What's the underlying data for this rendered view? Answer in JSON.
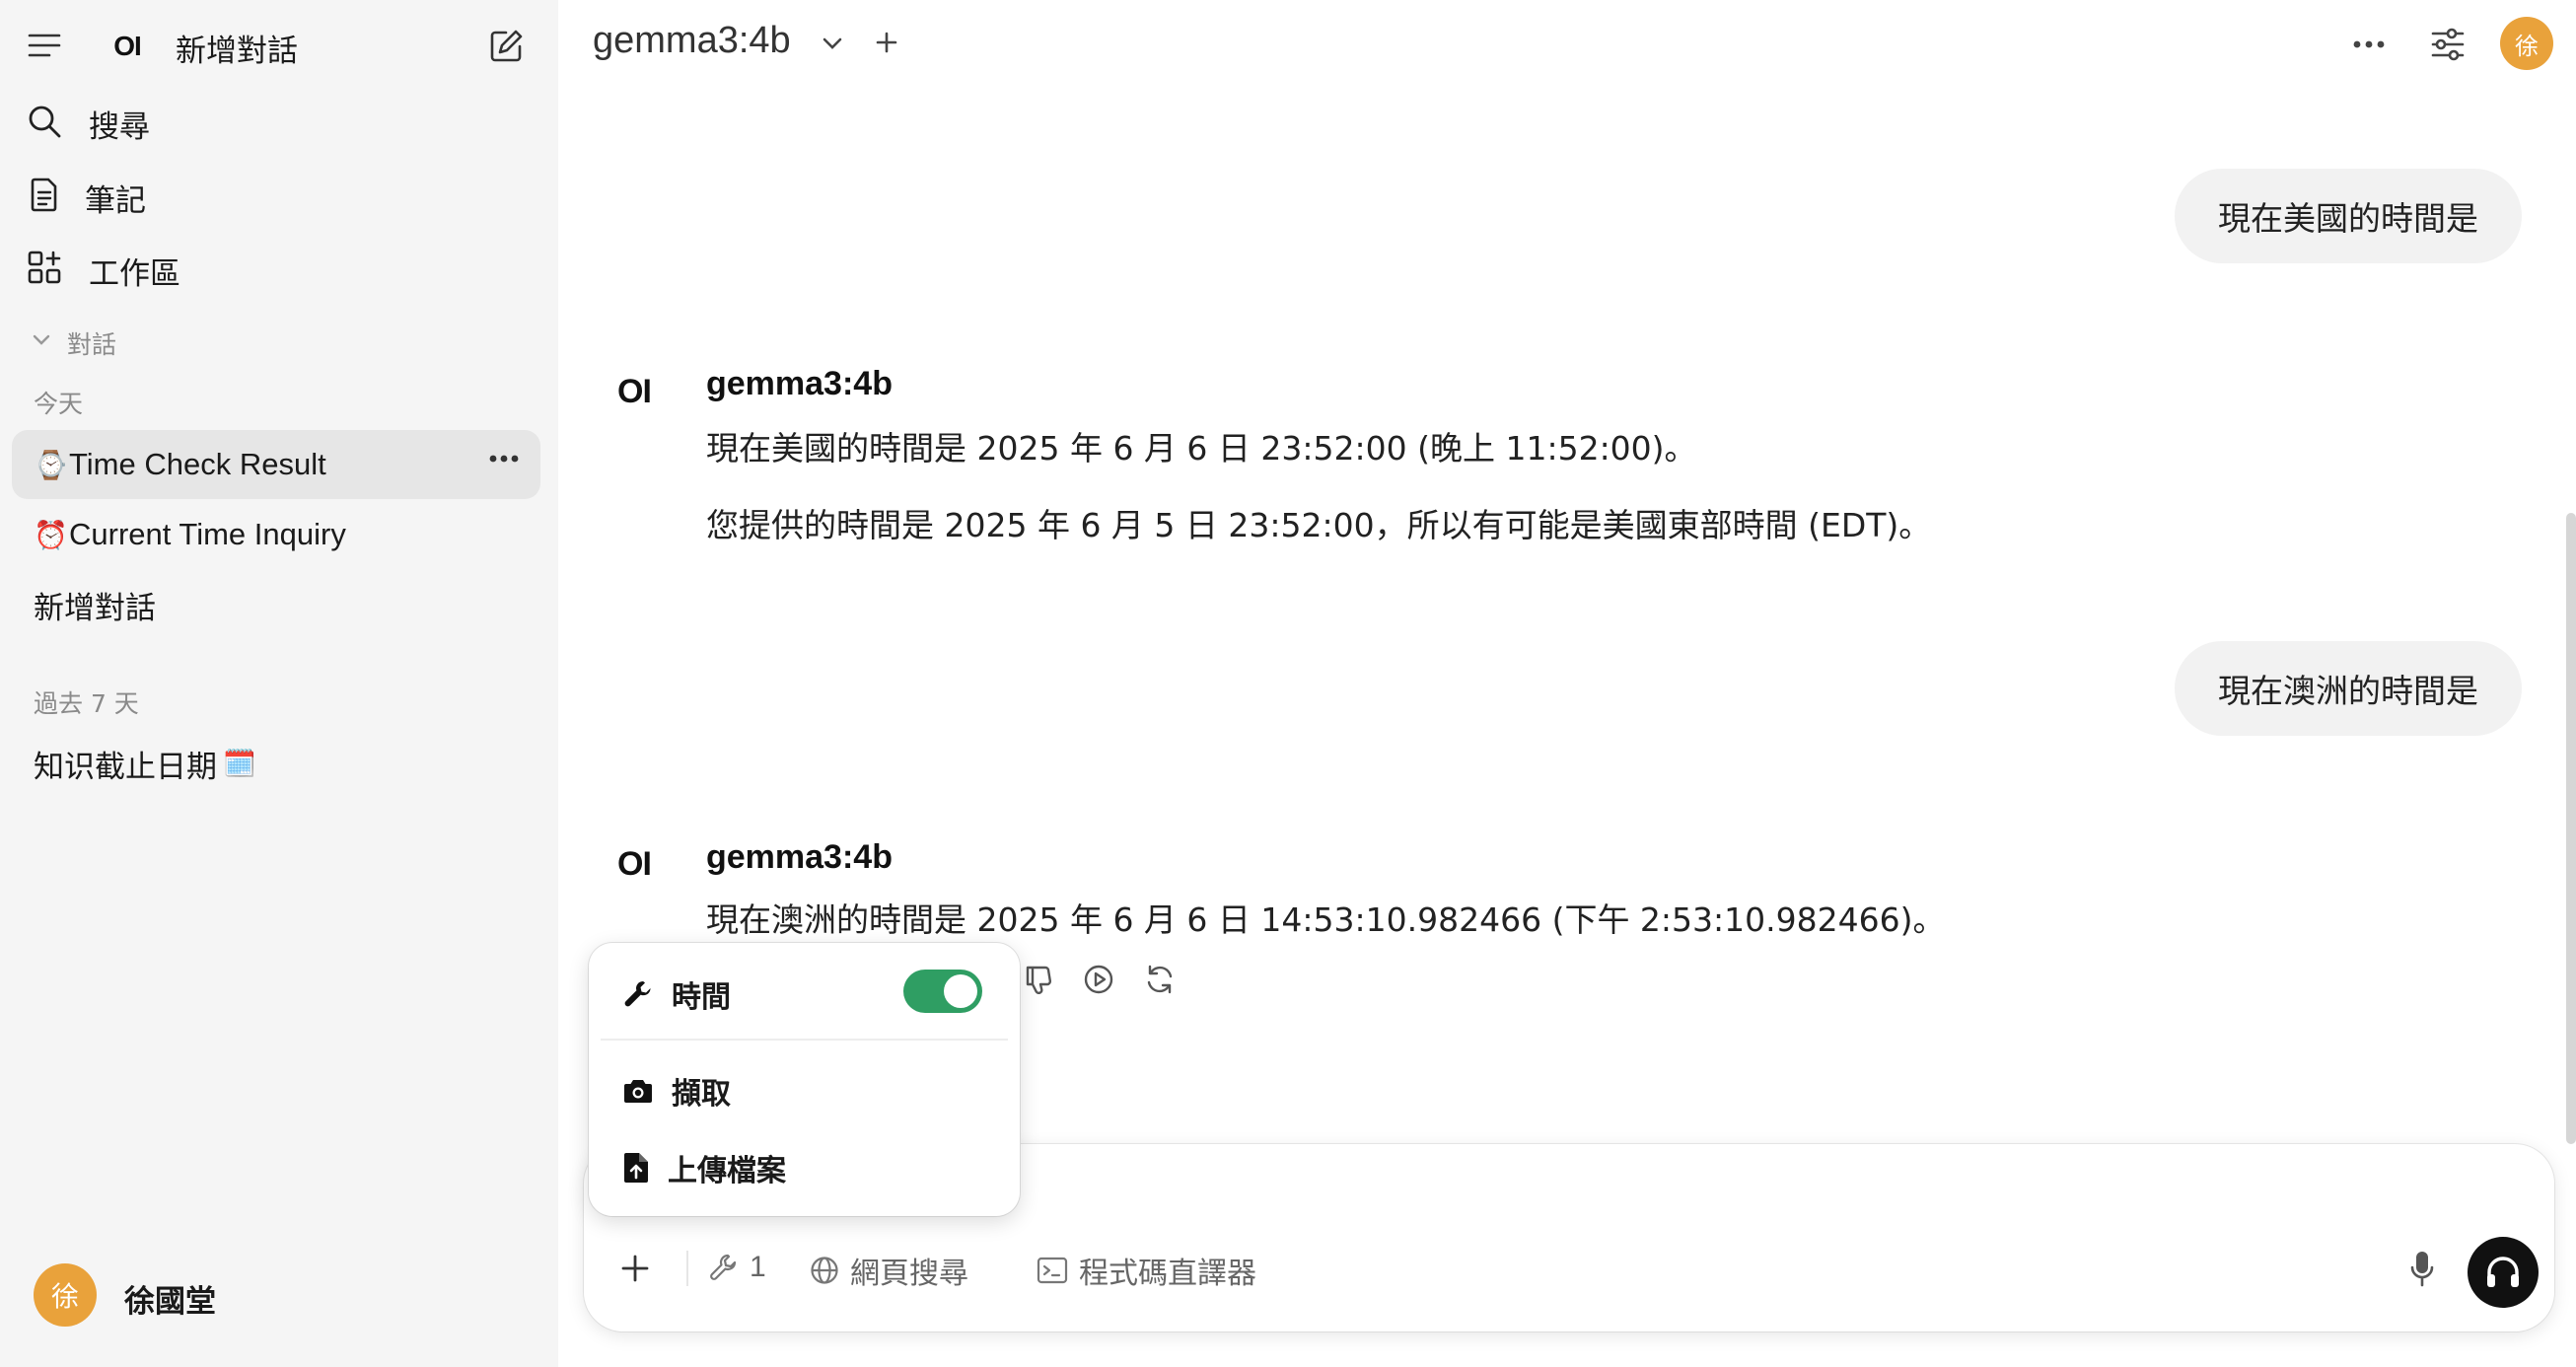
{
  "sidebar": {
    "new_chat_label": "新增對話",
    "logo_text": "OI",
    "nav": {
      "search": "搜尋",
      "notes": "筆記",
      "workspace": "工作區"
    },
    "conversations_header": "對話",
    "section_today": "今天",
    "today_items": [
      {
        "emoji": "⌚",
        "title": "Time Check Result"
      },
      {
        "emoji": "⏰",
        "title": "Current Time Inquiry"
      },
      {
        "emoji": "",
        "title": "新增對話"
      }
    ],
    "section_past7": "過去 7 天",
    "past7_items": [
      {
        "title": "知识截止日期",
        "emoji": "🗓️"
      }
    ],
    "user": {
      "avatar_char": "徐",
      "name": "徐國堂"
    }
  },
  "header": {
    "model_name": "gemma3:4b",
    "avatar_char": "徐"
  },
  "messages": [
    {
      "role": "user",
      "text": "現在美國的時間是"
    },
    {
      "role": "assistant",
      "model": "gemma3:4b",
      "logo": "OI",
      "lines": [
        "現在美國的時間是 2025 年 6 月 6 日 23:52:00 (晚上 11:52:00)。",
        "您提供的時間是 2025 年 6 月 5 日 23:52:00，所以有可能是美國東部時間 (EDT)。"
      ]
    },
    {
      "role": "user",
      "text": "現在澳洲的時間是"
    },
    {
      "role": "assistant",
      "model": "gemma3:4b",
      "logo": "OI",
      "lines": [
        "現在澳洲的時間是 2025 年 6 月 6 日 14:53:10.982466 (下午 2:53:10.982466)。"
      ]
    }
  ],
  "popup_menu": {
    "items": [
      {
        "label": "時間",
        "icon": "wrench-icon",
        "toggle": true
      },
      {
        "label": "擷取",
        "icon": "camera-icon"
      },
      {
        "label": "上傳檔案",
        "icon": "file-upload-icon"
      }
    ]
  },
  "composer": {
    "tools_count": "1",
    "web_search": "網頁搜尋",
    "code_interpreter": "程式碼直譯器"
  },
  "colors": {
    "accent_green": "#2f9e63",
    "avatar_orange": "#e9a23b",
    "sidebar_bg": "#f5f5f5"
  }
}
